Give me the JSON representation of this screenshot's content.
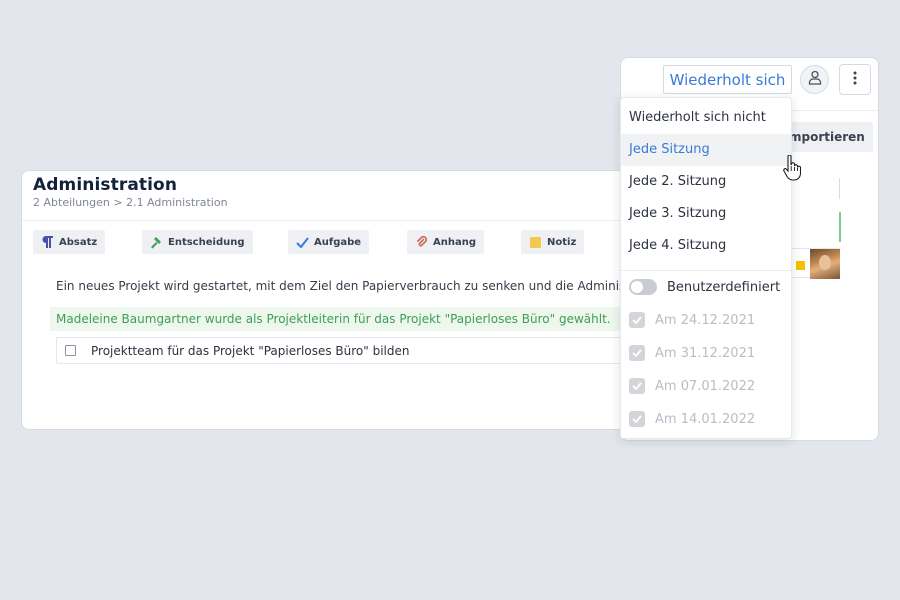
{
  "main": {
    "title": "Administration",
    "breadcrumb": "2 Abteilungen > 2.1 Administration",
    "toolbar": [
      {
        "label": "Absatz",
        "icon": "paragraph-icon",
        "color": "#4a4fa8"
      },
      {
        "label": "Entscheidung",
        "icon": "gavel-icon",
        "color": "#3f9e53"
      },
      {
        "label": "Aufgabe",
        "icon": "check-icon",
        "color": "#3a7bd5"
      },
      {
        "label": "Anhang",
        "icon": "paperclip-icon",
        "color": "#c96a5a"
      },
      {
        "label": "Notiz",
        "icon": "note-icon",
        "color": "#f2c94c"
      }
    ],
    "body_text": "Ein neues Projekt wird gestartet, mit dem Ziel den Papierverbrauch zu senken und die Administra",
    "decision_text": "Madeleine Baumgartner wurde als Projektleiterin für das Projekt \"Papierloses Büro\" gewählt.",
    "task_text": "Projektteam für das Projekt \"Papierloses Büro\" bilden"
  },
  "side": {
    "repeat_label": "Wiederholt sich",
    "import_label": "mportieren",
    "user_icon": "user-icon",
    "more_icon": "more-vertical-icon",
    "yellow_color": "#f2c200"
  },
  "dropdown": {
    "items": [
      "Wiederholt sich nicht",
      "Jede Sitzung",
      "Jede 2. Sitzung",
      "Jede 3. Sitzung",
      "Jede 4. Sitzung"
    ],
    "active_item": "Jede Sitzung",
    "custom_label": "Benutzerdefiniert",
    "custom_enabled": false,
    "dates": [
      "Am 24.12.2021",
      "Am 31.12.2021",
      "Am 07.01.2022",
      "Am 14.01.2022"
    ]
  },
  "colors": {
    "accent": "#3a7bd5",
    "success": "#3f9e53",
    "success_bg": "#edf7ee",
    "background": "#e3e6ec"
  }
}
